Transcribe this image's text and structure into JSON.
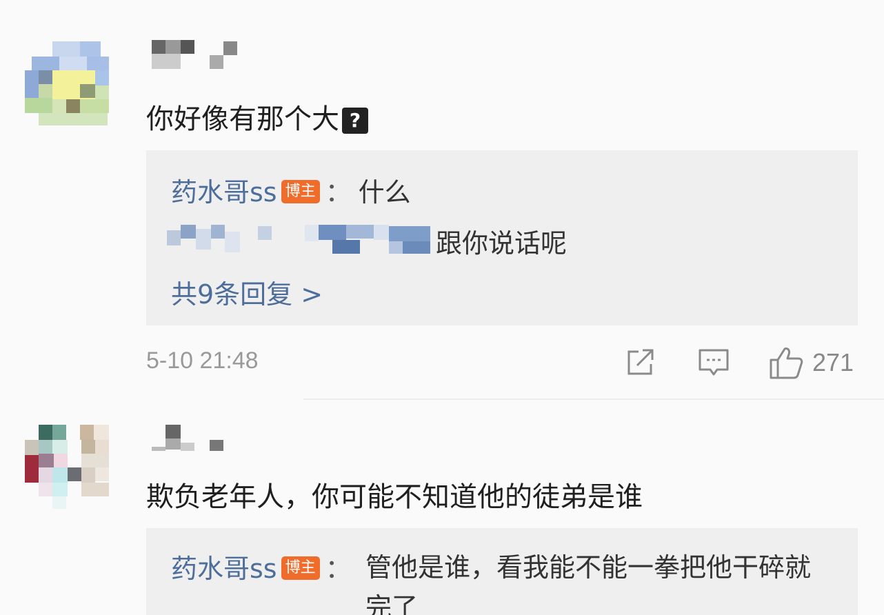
{
  "comments": [
    {
      "text": "你好像有那个大",
      "reply_preview": {
        "author": "药水哥ss",
        "badge": "博主",
        "colon": "：",
        "text": "什么",
        "second_line_text": "跟你说话呢",
        "reply_count_label": "共9条回复 >"
      },
      "timestamp": "5-10 21:48",
      "like_count": "271"
    },
    {
      "text": "欺负老年人，你可能不知道他的徒弟是谁",
      "reply_preview": {
        "author": "药水哥ss",
        "badge": "博主",
        "colon": "：",
        "text": "管他是谁，看我能不能一拳把他干碎就完了"
      }
    }
  ],
  "icons": {
    "share": "share-icon",
    "comment": "comment-icon",
    "like": "thumbs-up-icon",
    "question": "question-mark-icon"
  },
  "colors": {
    "author": "#4d6d9a",
    "badge": "#f06c2a",
    "reply_bg": "#efefef",
    "meta_gray": "#999999"
  }
}
